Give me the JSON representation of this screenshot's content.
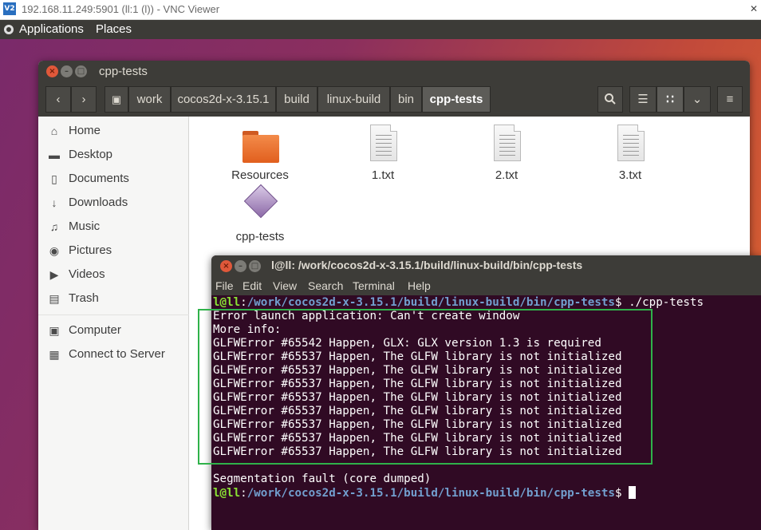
{
  "vnc": {
    "title": "192.168.11.249:5901 (ll:1 (l)) - VNC Viewer",
    "logo": "V2",
    "close_glyph": "✕"
  },
  "panel": {
    "applications": "Applications",
    "places": "Places"
  },
  "files": {
    "title": "cpp-tests",
    "breadcrumbs": [
      "work",
      "cocos2d-x-3.15.1",
      "build",
      "linux-build",
      "bin",
      "cpp-tests"
    ],
    "sidebar": [
      {
        "label": "Home",
        "icon": "home-icon"
      },
      {
        "label": "Desktop",
        "icon": "desktop-icon"
      },
      {
        "label": "Documents",
        "icon": "document-icon"
      },
      {
        "label": "Downloads",
        "icon": "download-icon"
      },
      {
        "label": "Music",
        "icon": "music-icon"
      },
      {
        "label": "Pictures",
        "icon": "camera-icon"
      },
      {
        "label": "Videos",
        "icon": "video-icon"
      },
      {
        "label": "Trash",
        "icon": "trash-icon"
      },
      {
        "label": "Computer",
        "icon": "computer-icon"
      },
      {
        "label": "Connect to Server",
        "icon": "server-icon"
      }
    ],
    "items": [
      {
        "name": "Resources",
        "type": "folder"
      },
      {
        "name": "1.txt",
        "type": "text"
      },
      {
        "name": "2.txt",
        "type": "text"
      },
      {
        "name": "3.txt",
        "type": "text"
      },
      {
        "name": "cpp-tests",
        "type": "executable"
      }
    ]
  },
  "terminal": {
    "title": "l@ll: /work/cocos2d-x-3.15.1/build/linux-build/bin/cpp-tests",
    "menu": [
      "File",
      "Edit",
      "View",
      "Search",
      "Terminal",
      "Help"
    ],
    "prompt_user": "l@ll",
    "prompt_sep": ":",
    "prompt_path": "/work/cocos2d-x-3.15.1/build/linux-build/bin/cpp-tests",
    "prompt_end": "$ ",
    "command": "./cpp-tests",
    "output": [
      "Error launch application: Can't create window",
      "More info:",
      "GLFWError #65542 Happen, GLX: GLX version 1.3 is required",
      "GLFWError #65537 Happen, The GLFW library is not initialized",
      "GLFWError #65537 Happen, The GLFW library is not initialized",
      "GLFWError #65537 Happen, The GLFW library is not initialized",
      "GLFWError #65537 Happen, The GLFW library is not initialized",
      "GLFWError #65537 Happen, The GLFW library is not initialized",
      "GLFWError #65537 Happen, The GLFW library is not initialized",
      "GLFWError #65537 Happen, The GLFW library is not initialized",
      "GLFWError #65537 Happen, The GLFW library is not initialized",
      "",
      "Segmentation fault (core dumped)"
    ],
    "colors": {
      "background": "#300a24",
      "user": "#8ae234",
      "path": "#729fcf",
      "text": "#ffffff"
    }
  },
  "highlight_color": "#2fb24a"
}
